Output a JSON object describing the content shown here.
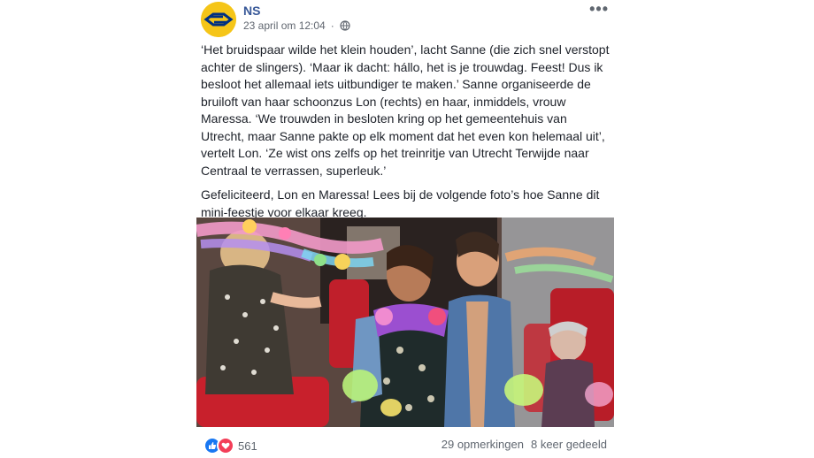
{
  "post": {
    "page_name": "NS",
    "timestamp": "23 april om 12:04",
    "privacy_icon": "globe-icon",
    "more_icon": "more-options-icon",
    "paragraphs": [
      "‘Het bruidspaar wilde het klein houden’, lacht Sanne (die zich snel verstopt achter de slingers). ‘Maar ik dacht: hállo, het is je trouwdag. Feest! Dus ik besloot het allemaal iets uitbundiger te maken.’ Sanne organiseerde de bruiloft van haar schoonzus Lon (rechts) en haar, inmiddels, vrouw Maressa. ‘We trouwden in besloten kring op het gemeentehuis van Utrecht, maar Sanne pakte op elk moment dat het even kon helemaal uit’, vertelt Lon. ‘Ze wist ons zelfs op het treinritje van Utrecht Terwijde naar Centraal te verrassen, superleuk.’",
      "Gefeliciteerd, Lon en Maressa! Lees bij de volgende foto’s hoe Sanne dit mini-feestje voor elkaar kreeg."
    ]
  },
  "footer": {
    "reaction_icons": [
      "like-icon",
      "love-icon"
    ],
    "reaction_count": "561",
    "comments": "29 opmerkingen",
    "shares": "8 keer gedeeld"
  },
  "colors": {
    "page_name": "#385898",
    "meta": "#616770",
    "like": "#1877f2",
    "love": "#f33e58",
    "ns_yellow": "#f5c518",
    "ns_blue": "#003082"
  }
}
